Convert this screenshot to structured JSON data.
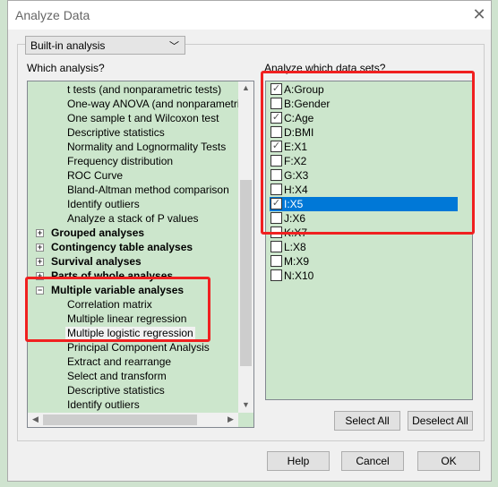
{
  "window": {
    "title": "Analyze Data",
    "close_icon": "close-icon"
  },
  "analysis_type": {
    "selected": "Built-in analysis"
  },
  "which_analysis_label": "Which analysis?",
  "tree": [
    {
      "label": "t tests (and nonparametric tests)",
      "type": "child"
    },
    {
      "label": "One-way ANOVA (and nonparametric or",
      "type": "child"
    },
    {
      "label": "One sample t and Wilcoxon test",
      "type": "child"
    },
    {
      "label": "Descriptive statistics",
      "type": "child"
    },
    {
      "label": "Normality and Lognormality Tests",
      "type": "child"
    },
    {
      "label": "Frequency distribution",
      "type": "child"
    },
    {
      "label": "ROC Curve",
      "type": "child"
    },
    {
      "label": "Bland-Altman method comparison",
      "type": "child"
    },
    {
      "label": "Identify outliers",
      "type": "child"
    },
    {
      "label": "Analyze a stack of P values",
      "type": "child"
    },
    {
      "label": "Grouped analyses",
      "type": "header",
      "expanded": false
    },
    {
      "label": "Contingency table analyses",
      "type": "header",
      "expanded": false
    },
    {
      "label": "Survival analyses",
      "type": "header",
      "expanded": false
    },
    {
      "label": "Parts of whole analyses",
      "type": "header",
      "expanded": false
    },
    {
      "label": "Multiple variable analyses",
      "type": "header",
      "expanded": true
    },
    {
      "label": "Correlation matrix",
      "type": "child"
    },
    {
      "label": "Multiple linear regression",
      "type": "child"
    },
    {
      "label": "Multiple logistic regression",
      "type": "child",
      "selected": true
    },
    {
      "label": "Principal Component Analysis",
      "type": "child"
    },
    {
      "label": "Extract and rearrange",
      "type": "child"
    },
    {
      "label": "Select and transform",
      "type": "child"
    },
    {
      "label": "Descriptive statistics",
      "type": "child"
    },
    {
      "label": "Identify outliers",
      "type": "child"
    }
  ],
  "datasets_label": "Analyze which data sets?",
  "datasets": [
    {
      "label": "A:Group",
      "checked": true
    },
    {
      "label": "B:Gender",
      "checked": false
    },
    {
      "label": "C:Age",
      "checked": true
    },
    {
      "label": "D:BMI",
      "checked": false
    },
    {
      "label": "E:X1",
      "checked": true
    },
    {
      "label": "F:X2",
      "checked": false
    },
    {
      "label": "G:X3",
      "checked": false
    },
    {
      "label": "H:X4",
      "checked": false
    },
    {
      "label": "I:X5",
      "checked": true,
      "highlighted": true
    },
    {
      "label": "J:X6",
      "checked": false
    },
    {
      "label": "K:X7",
      "checked": false
    },
    {
      "label": "L:X8",
      "checked": false
    },
    {
      "label": "M:X9",
      "checked": false
    },
    {
      "label": "N:X10",
      "checked": false
    }
  ],
  "buttons": {
    "select_all": "Select All",
    "deselect_all": "Deselect All",
    "help": "Help",
    "cancel": "Cancel",
    "ok": "OK"
  },
  "colors": {
    "list_bg": "#cce6cc",
    "highlight": "#0078d7",
    "annotation": "#f02020"
  }
}
